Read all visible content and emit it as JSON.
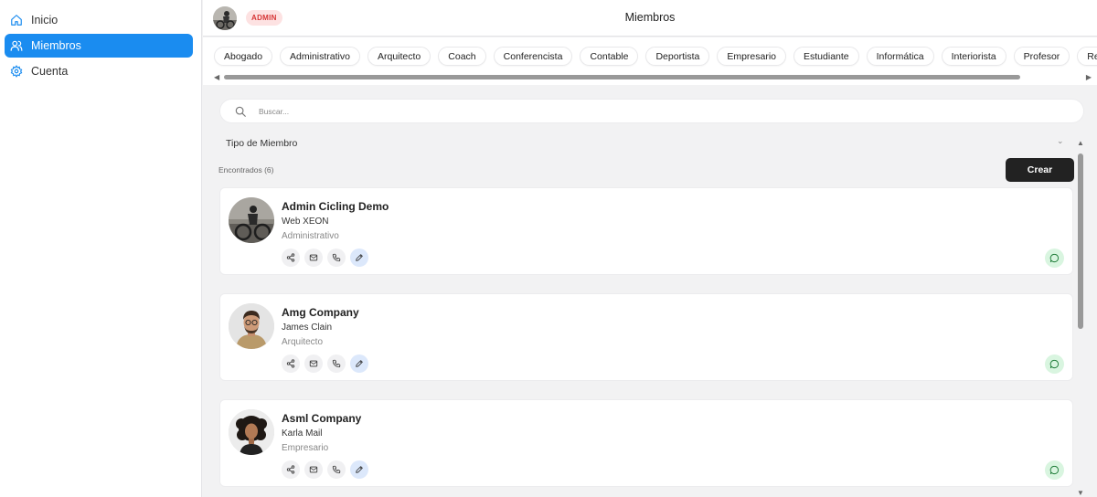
{
  "sidebar": {
    "items": [
      {
        "label": "Inicio",
        "icon": "home-icon",
        "active": false
      },
      {
        "label": "Miembros",
        "icon": "users-icon",
        "active": true
      },
      {
        "label": "Cuenta",
        "icon": "gear-icon",
        "active": false
      }
    ]
  },
  "header": {
    "badge": "ADMIN",
    "title": "Miembros"
  },
  "categories": [
    "Abogado",
    "Administrativo",
    "Arquitecto",
    "Coach",
    "Conferencista",
    "Contable",
    "Deportista",
    "Empresario",
    "Estudiante",
    "Informática",
    "Interiorista",
    "Profesor",
    "Real State"
  ],
  "search": {
    "placeholder": "Buscar...",
    "value": ""
  },
  "filter": {
    "label": "Tipo de Miembro"
  },
  "results": {
    "found_label": "Encontrados (6)",
    "create_label": "Crear"
  },
  "members": [
    {
      "company": "Admin Cicling Demo",
      "person": "Web XEON",
      "type": "Administrativo"
    },
    {
      "company": "Amg Company",
      "person": "James Clain",
      "type": "Arquitecto"
    },
    {
      "company": "Asml Company",
      "person": "Karla Mail",
      "type": "Empresario"
    }
  ],
  "colors": {
    "accent": "#1a8cf0",
    "badge_bg": "#fde2e2",
    "badge_text": "#d63636",
    "create_button": "#222222",
    "chat": "#d9f5e0",
    "edit": "#dce8fb"
  }
}
